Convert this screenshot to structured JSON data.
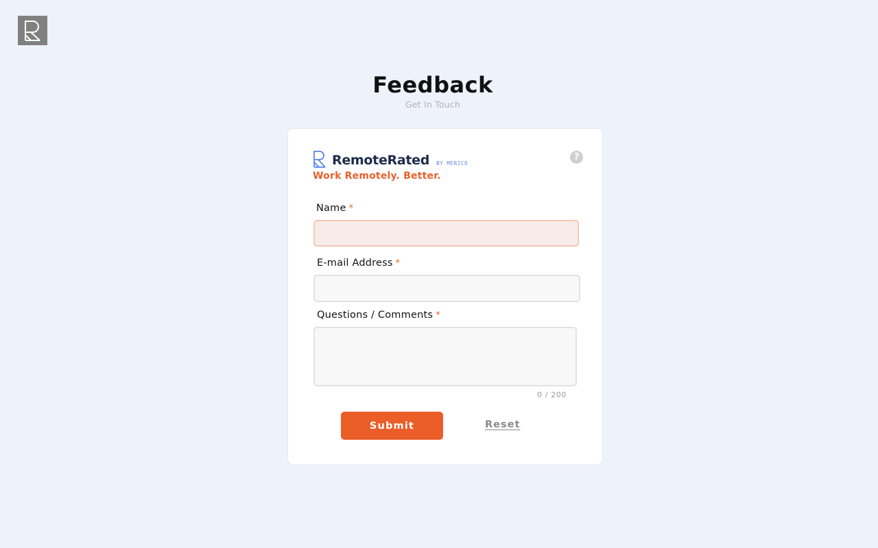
{
  "header": {
    "title": "Feedback",
    "subtitle": "Get In Touch"
  },
  "brand": {
    "name": "RemoteRated",
    "by": "BY MERICO",
    "tagline": "Work Remotely. Better.",
    "help_glyph": "?"
  },
  "form": {
    "name": {
      "label": "Name",
      "required_mark": "*",
      "value": "",
      "state": "error"
    },
    "email": {
      "label": "E-mail Address",
      "required_mark": "*",
      "value": ""
    },
    "comments": {
      "label": "Questions / Comments",
      "required_mark": "*",
      "value": "",
      "counter": "0 / 200"
    },
    "submit_label": "Submit",
    "reset_label": "Reset"
  },
  "colors": {
    "accent": "#eb5e28",
    "brand_navy": "#1d2b4c",
    "brand_blue": "#5b86e5",
    "background": "#eef3fb"
  },
  "icons": {
    "corner_logo": "remoterated-logo-icon",
    "brand_mark": "remoterated-mark-icon",
    "help": "help-icon"
  }
}
